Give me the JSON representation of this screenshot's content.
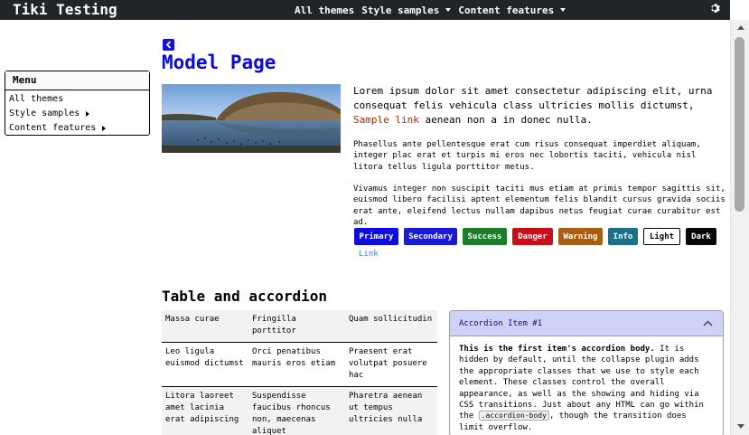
{
  "site": {
    "brand": "Tiki Testing"
  },
  "topnav": {
    "items": [
      {
        "label": "All themes",
        "dropdown": false
      },
      {
        "label": "Style samples",
        "dropdown": true
      },
      {
        "label": "Content features",
        "dropdown": true
      }
    ]
  },
  "menu": {
    "title": "Menu",
    "items": [
      {
        "label": "All themes",
        "submenu": false
      },
      {
        "label": "Style samples",
        "submenu": true
      },
      {
        "label": "Content features",
        "submenu": true
      }
    ]
  },
  "page": {
    "title": "Model Page",
    "lead_text": "Lorem ipsum dolor sit amet consectetur adipiscing elit, urna consequat felis vehicula class ultricies mollis dictumst, ",
    "lead_link": "Sample link",
    "lead_text_end": " aenean non a in donec nulla.",
    "para1": "Phasellus ante pellentesque erat cum risus consequat imperdiet aliquam, integer plac erat et turpis mi eros nec lobortis taciti, vehicula nisl litora tellus ligula porttitor metus.",
    "para2": "Vivamus integer non suscipit taciti mus etiam at primis tempor sagittis sit, euismod libero facilisi aptent elementum felis blandit cursus gravida sociis erat ante, eleifend lectus nullam dapibus netus feugiat curae curabitur est ad."
  },
  "buttons": [
    {
      "label": "Primary",
      "bg": "#0d0de0",
      "fg": "#ffffff",
      "border": "#0d0de0"
    },
    {
      "label": "Secondary",
      "bg": "#1a1ad6",
      "fg": "#ffffff",
      "border": "#1a1ad6"
    },
    {
      "label": "Success",
      "bg": "#1e7d2a",
      "fg": "#ffffff",
      "border": "#1e7d2a"
    },
    {
      "label": "Danger",
      "bg": "#c9101a",
      "fg": "#ffffff",
      "border": "#c9101a"
    },
    {
      "label": "Warning",
      "bg": "#a85d15",
      "fg": "#ffffff",
      "border": "#a85d15"
    },
    {
      "label": "Info",
      "bg": "#1a6f8a",
      "fg": "#ffffff",
      "border": "#1a6f8a"
    },
    {
      "label": "Light",
      "bg": "#ffffff",
      "fg": "#000000",
      "border": "#000000"
    },
    {
      "label": "Dark",
      "bg": "#0a0a0a",
      "fg": "#ffffff",
      "border": "#0a0a0a"
    }
  ],
  "link_button": "Link",
  "section": {
    "title": "Table and accordion"
  },
  "table": {
    "headers": [
      "Massa curae",
      "Fringilla porttitor",
      "Quam sollicitudin"
    ],
    "rows": [
      [
        "Leo ligula euismod dictumst",
        "Orci penatibus mauris eros etiam",
        "Praesent erat volutpat posuere hac"
      ],
      [
        "Litora laoreet amet lacinia erat adipiscing",
        "Suspendisse faucibus rhoncus non, maecenas aliquet",
        "Pharetra aenean ut tempus ultricies nulla"
      ]
    ]
  },
  "accordion": {
    "item_title": "Accordion Item #1",
    "body_strong": "This is the first item's accordion body.",
    "body_text": " It is hidden by default, until the collapse plugin adds the appropriate classes that we use to style each element. These classes control the overall appearance, as well as the showing and hiding via CSS transitions. Just about any HTML can go within the ",
    "body_code": ".accordion-body",
    "body_end": ", though the transition does limit overflow."
  }
}
